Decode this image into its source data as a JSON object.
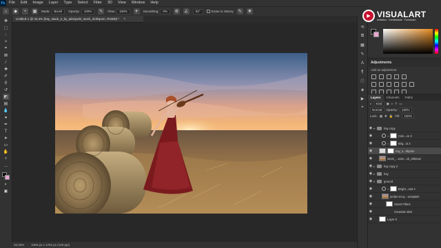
{
  "menubar": {
    "logo": "Ps",
    "items": [
      "File",
      "Edit",
      "Image",
      "Layer",
      "Type",
      "Select",
      "Filter",
      "3D",
      "View",
      "Window",
      "Help"
    ]
  },
  "options": {
    "mode_label": "Mode:",
    "mode_value": "Brush",
    "opacity_label": "Opacity:",
    "opacity_value": "100%",
    "flow_label": "Flow:",
    "flow_value": "100%",
    "smoothing_label": "Smoothing:",
    "smoothing_value": "0%",
    "angle_value": "82°",
    "erase_history_label": "Erase to History"
  },
  "document": {
    "tab_title": "Untitled-1 @ 33,3% (hay_stack_2_by_alienjacki_stock_d10bp4m, RGB/8) *",
    "close": "×"
  },
  "status": {
    "zoom": "33,33%",
    "dimensions": "3460 px x 1754 px (100 ppi)"
  },
  "watermark": {
    "title": "VISUALART",
    "subtitle": "Invitation · Creatividade · Formación"
  },
  "adjustments": {
    "title": "Adjustments",
    "subtitle": "Add an adjustment"
  },
  "layers_panel": {
    "tabs": [
      "Layers",
      "Channels",
      "Paths"
    ],
    "kind_label": "Kind",
    "blend_mode": "Normal",
    "opacity_label": "Opacity:",
    "opacity_value": "100%",
    "lock_label": "Lock:",
    "fill_label": "Fill:",
    "fill_value": "100%",
    "layers": [
      {
        "name": "hay copy",
        "type": "folder",
        "indent": 0
      },
      {
        "name": "Colo...ce 2",
        "type": "adjustment",
        "indent": 1
      },
      {
        "name": "Brig...st 3",
        "type": "adjustment",
        "indent": 1
      },
      {
        "name": "hay_s...0bp4m",
        "type": "photo",
        "indent": 1,
        "selected": true
      },
      {
        "name": "stock_...wom...ck_d4kteaz",
        "type": "photo",
        "indent": 1
      },
      {
        "name": "hay copy 2",
        "type": "folder",
        "indent": 0
      },
      {
        "name": "hay",
        "type": "folder",
        "indent": 0
      },
      {
        "name": "ground",
        "type": "folder",
        "indent": 0
      },
      {
        "name": "Bright...rast 2",
        "type": "adjustment",
        "indent": 1
      },
      {
        "name": "jordan-mcq...-unsplash",
        "type": "photo",
        "indent": 1
      },
      {
        "name": "Smart Filters",
        "type": "filter",
        "indent": 2
      },
      {
        "name": "Gaussian Blur",
        "type": "filter",
        "indent": 2
      },
      {
        "name": "Layer 0",
        "type": "photo",
        "indent": 0
      }
    ]
  },
  "colors": {
    "foreground": "#111111",
    "background": "#e9a6d0"
  },
  "icons": {
    "tools": [
      "move-icon",
      "artboard-icon",
      "marquee-icon",
      "lasso-icon",
      "quick-select-icon",
      "crop-icon",
      "frame-icon",
      "eyedropper-icon",
      "healing-icon",
      "brush-icon",
      "clone-stamp-icon",
      "history-brush-icon",
      "eraser-icon",
      "gradient-icon",
      "blur-icon",
      "dodge-icon",
      "pen-icon",
      "type-icon",
      "path-select-icon",
      "rectangle-icon",
      "hand-icon",
      "zoom-icon"
    ]
  }
}
